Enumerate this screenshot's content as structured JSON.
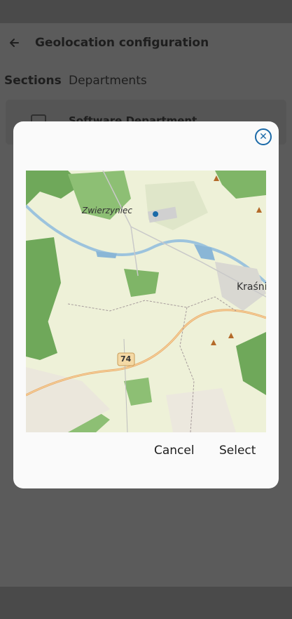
{
  "header": {
    "title": "Geolocation configuration"
  },
  "tabs": [
    {
      "label": "Sections",
      "active": true
    },
    {
      "label": "Departments",
      "active": false
    }
  ],
  "list": {
    "first_item": "Software Department"
  },
  "dialog": {
    "map_labels": {
      "town1": "Zwierzyniec",
      "town2": "Kraśnik",
      "road": "74"
    },
    "cancel_label": "Cancel",
    "select_label": "Select"
  },
  "colors": {
    "accent": "#1b6aa8"
  }
}
